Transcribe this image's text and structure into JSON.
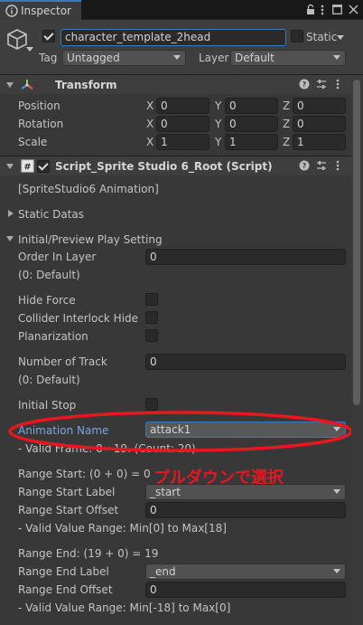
{
  "tab": {
    "title": "Inspector",
    "lock_icon": "lock-icon",
    "menu_icon": "kebab-menu-icon",
    "maximize_icon": "maximize-icon",
    "close_icon": "close-icon"
  },
  "object": {
    "active": true,
    "name": "character_template_2head",
    "static_label": "Static",
    "tag_label": "Tag",
    "tag_value": "Untagged",
    "layer_label": "Layer",
    "layer_value": "Default"
  },
  "transform": {
    "title": "Transform",
    "position_label": "Position",
    "rotation_label": "Rotation",
    "scale_label": "Scale",
    "position": {
      "x": "0",
      "y": "0",
      "z": "0"
    },
    "rotation": {
      "x": "0",
      "y": "0",
      "z": "0"
    },
    "scale": {
      "x": "1",
      "y": "1",
      "z": "1"
    },
    "axis_x": "X",
    "axis_y": "Y",
    "axis_z": "Z"
  },
  "script": {
    "title": "Script_Sprite Studio 6_Root (Script)",
    "enabled": true,
    "subtitle": "[SpriteStudio6 Animation]",
    "static_datas": "Static Datas",
    "initial_setting": "Initial/Preview Play Setting",
    "order_label": "Order In Layer",
    "order_value": "0",
    "order_default": "(0: Default)",
    "hide_force": "Hide Force",
    "collider": "Collider Interlock Hide",
    "planarization": "Planarization",
    "track_label": "Number of Track",
    "track_value": "0",
    "track_default": "(0: Default)",
    "initial_stop": "Initial Stop",
    "anim_name_label": "Animation Name",
    "anim_name_value": "attack1",
    "anim_valid": "- Valid Frame: 0 - 19. (Count: 20)",
    "range_start": "Range Start: (0 + 0) = 0",
    "range_start_label": "Range Start Label",
    "range_start_label_value": "_start",
    "range_start_offset": "Range Start Offset",
    "range_start_offset_value": "0",
    "range_start_valid": "- Valid Value Range: Min[0] to Max[18]",
    "range_end": "Range End: (19 + 0) = 19",
    "range_end_label": "Range End Label",
    "range_end_label_value": "_end",
    "range_end_offset": "Range End Offset",
    "range_end_offset_value": "0",
    "range_end_valid": "- Valid Value Range: Min[-18] to Max[0]"
  },
  "annotation": {
    "text": "プルダウンで選択",
    "color": "#e8161e"
  },
  "colors": {
    "accent": "#3a79bb",
    "annotation": "#e8161e"
  }
}
